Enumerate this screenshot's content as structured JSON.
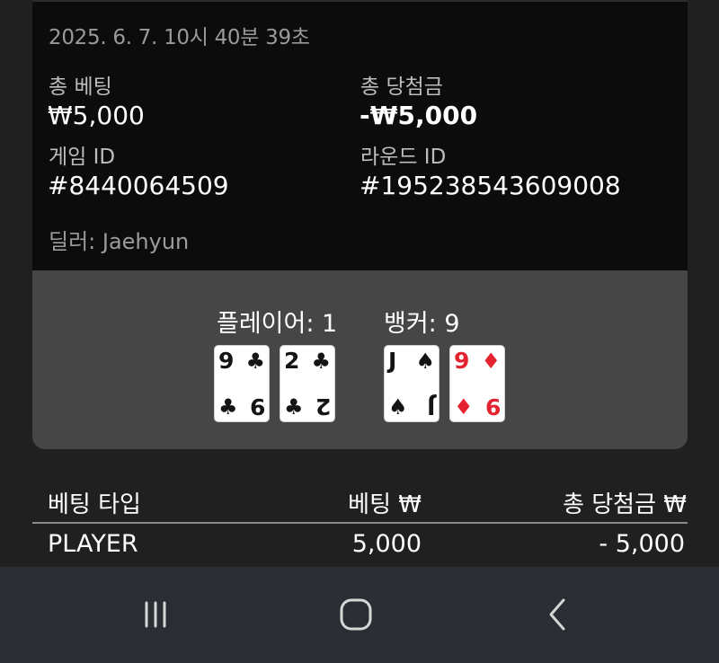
{
  "detail": {
    "timestamp": "2025. 6. 7. 10시 40분 39초",
    "total_bet_label": "총 베팅",
    "total_bet_value": "₩5,000",
    "total_win_label": "총 당첨금",
    "total_win_value": "-₩5,000",
    "game_id_label": "게임 ID",
    "game_id_value": "#8440064509",
    "round_id_label": "라운드 ID",
    "round_id_value": "#195238543609008",
    "dealer": "딜러: Jaehyun"
  },
  "hands": {
    "player_label": "플레이어: 1",
    "banker_label": "뱅커: 9",
    "player_cards": [
      {
        "rank": "9",
        "suit": "♣",
        "color": "#141414"
      },
      {
        "rank": "2",
        "suit": "♣",
        "color": "#141414"
      }
    ],
    "banker_cards": [
      {
        "rank": "J",
        "suit": "♠",
        "color": "#141414"
      },
      {
        "rank": "9",
        "suit": "♦",
        "color": "#e4232e"
      }
    ]
  },
  "bet_table": {
    "headers": [
      "베팅 타입",
      "베팅 ₩",
      "총 당첨금 ₩"
    ],
    "rows": [
      {
        "type": "PLAYER",
        "bet": "5,000",
        "win": "- 5,000"
      }
    ]
  },
  "navbar": {
    "icons": [
      "recent-apps-icon",
      "home-icon",
      "back-icon"
    ]
  }
}
